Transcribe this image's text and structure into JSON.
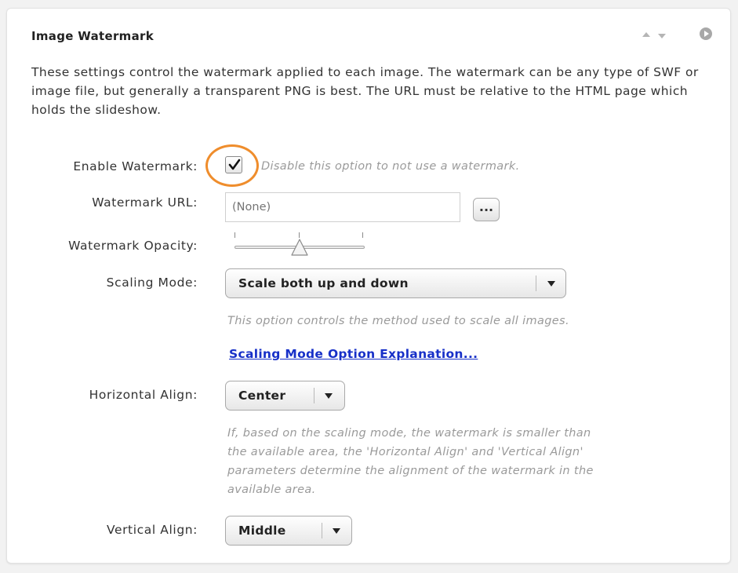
{
  "panel": {
    "title": "Image Watermark",
    "intro": "These settings control the watermark applied to each image.  The watermark can be any type of SWF or image file, but generally a transparent PNG is best.  The URL must be relative to the HTML page which holds the slideshow."
  },
  "fields": {
    "enable_watermark": {
      "label": "Enable Watermark:",
      "checked": true,
      "hint": "Disable this option to not use a watermark."
    },
    "watermark_url": {
      "label": "Watermark URL:",
      "placeholder": "(None)",
      "browse_label": "..."
    },
    "watermark_opacity": {
      "label": "Watermark Opacity:",
      "value_fraction": 0.5
    },
    "scaling_mode": {
      "label": "Scaling Mode:",
      "selected": "Scale both up and down",
      "hint": "This option controls the method used to scale all images.",
      "link": "Scaling Mode Option Explanation..."
    },
    "horizontal_align": {
      "label": "Horizontal Align:",
      "selected": "Center",
      "hint_lines": [
        "If, based on the scaling mode, the watermark is smaller than",
        "the available area, the 'Horizontal Align' and 'Vertical Align'",
        "parameters determine the alignment of the watermark in the",
        "available area."
      ]
    },
    "vertical_align": {
      "label": "Vertical Align:",
      "selected": "Middle"
    }
  },
  "colors": {
    "highlight_ring": "#ef8d2c",
    "link": "#1730c8"
  },
  "icons": [
    "move-up-icon",
    "move-down-icon",
    "play-icon",
    "checkmark-icon",
    "dropdown-arrow-icon"
  ]
}
